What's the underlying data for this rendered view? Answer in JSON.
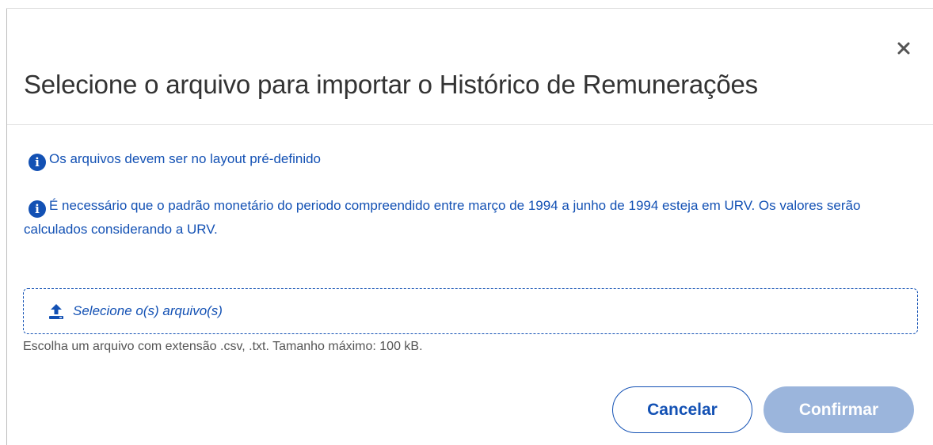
{
  "dialog": {
    "title": "Selecione o arquivo para importar o Histórico de Remunerações",
    "close_symbol": "×",
    "info_icon_symbol": "i",
    "info_messages": [
      "Os arquivos devem ser no layout pré-definido",
      "É necessário que o padrão monetário do periodo compreendido entre março de 1994 a junho de 1994 esteja em URV. Os valores serão calculados considerando a URV."
    ],
    "upload": {
      "label": "Selecione o(s) arquivo(s)",
      "icon": "upload-icon"
    },
    "help_text": "Escolha um arquivo com extensão .csv, .txt. Tamanho máximo: 100 kB.",
    "buttons": {
      "cancel": "Cancelar",
      "confirm": "Confirmar"
    }
  },
  "colors": {
    "primary": "#1351b4",
    "disabled_button": "#9bb5dc",
    "title_text": "#333333",
    "help_text": "#555555"
  }
}
